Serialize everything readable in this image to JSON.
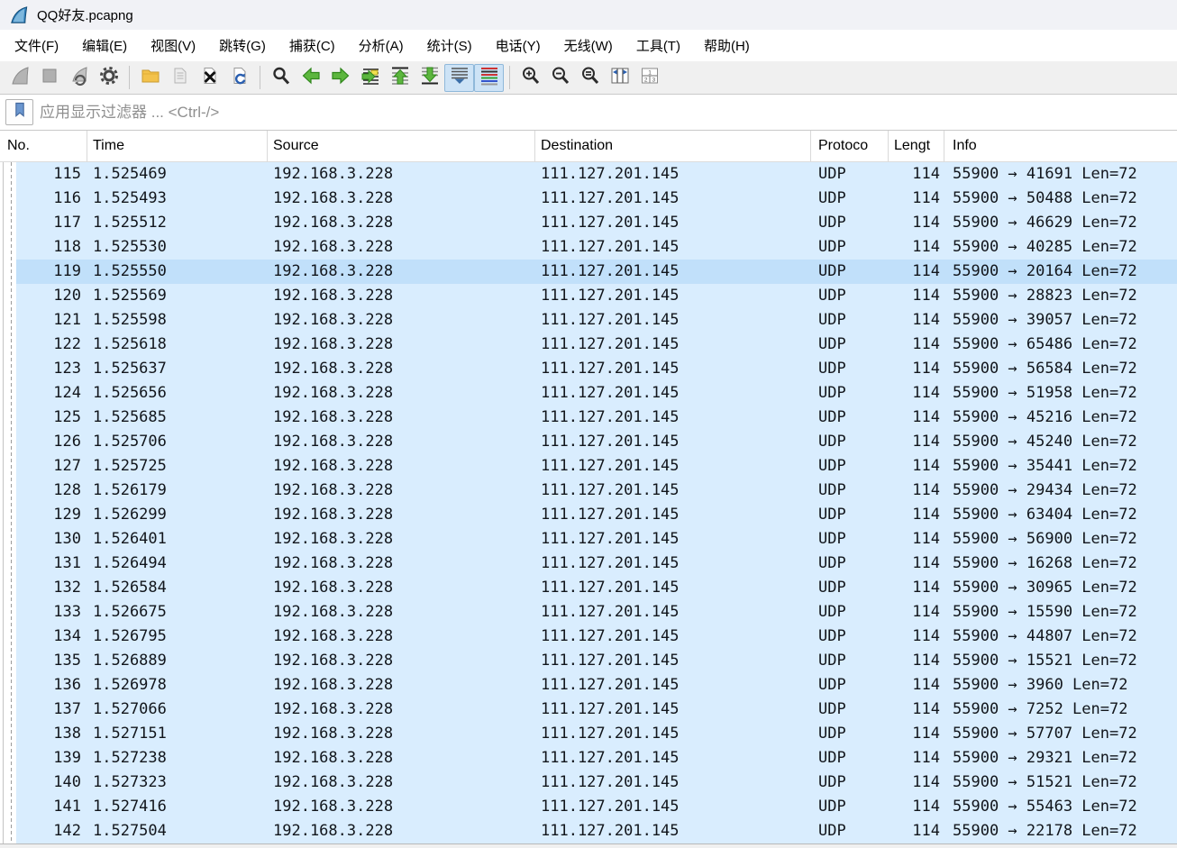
{
  "window": {
    "title": "QQ好友.pcapng",
    "app_icon": "wireshark-fin-icon"
  },
  "menu": {
    "items": [
      {
        "name": "file",
        "label": "文件(F)"
      },
      {
        "name": "edit",
        "label": "编辑(E)"
      },
      {
        "name": "view",
        "label": "视图(V)"
      },
      {
        "name": "go",
        "label": "跳转(G)"
      },
      {
        "name": "capture",
        "label": "捕获(C)"
      },
      {
        "name": "analyze",
        "label": "分析(A)"
      },
      {
        "name": "statistics",
        "label": "统计(S)"
      },
      {
        "name": "telephony",
        "label": "电话(Y)"
      },
      {
        "name": "wireless",
        "label": "无线(W)"
      },
      {
        "name": "tools",
        "label": "工具(T)"
      },
      {
        "name": "help",
        "label": "帮助(H)"
      }
    ]
  },
  "toolbar": {
    "buttons": [
      {
        "icon": "start-capture-icon",
        "enabled": false,
        "active": false
      },
      {
        "icon": "stop-capture-icon",
        "enabled": false,
        "active": false
      },
      {
        "icon": "restart-capture-icon",
        "enabled": false,
        "active": false
      },
      {
        "icon": "capture-options-icon",
        "enabled": true,
        "active": false
      },
      {
        "icon": "open-file-icon",
        "enabled": true,
        "active": false
      },
      {
        "icon": "save-file-icon",
        "enabled": false,
        "active": false
      },
      {
        "icon": "close-file-icon",
        "enabled": true,
        "active": false
      },
      {
        "icon": "reload-file-icon",
        "enabled": true,
        "active": false
      },
      {
        "icon": "find-packet-icon",
        "enabled": true,
        "active": false
      },
      {
        "icon": "go-back-icon",
        "enabled": true,
        "active": false
      },
      {
        "icon": "go-forward-icon",
        "enabled": true,
        "active": false
      },
      {
        "icon": "go-to-packet-icon",
        "enabled": true,
        "active": false
      },
      {
        "icon": "go-first-icon",
        "enabled": true,
        "active": false
      },
      {
        "icon": "go-last-icon",
        "enabled": true,
        "active": false
      },
      {
        "icon": "auto-scroll-icon",
        "enabled": true,
        "active": true
      },
      {
        "icon": "colorize-icon",
        "enabled": true,
        "active": true
      },
      {
        "icon": "zoom-in-icon",
        "enabled": true,
        "active": false
      },
      {
        "icon": "zoom-out-icon",
        "enabled": true,
        "active": false
      },
      {
        "icon": "zoom-original-icon",
        "enabled": true,
        "active": false
      },
      {
        "icon": "resize-columns-icon",
        "enabled": true,
        "active": false
      },
      {
        "icon": "layout-icon",
        "enabled": true,
        "active": false
      }
    ]
  },
  "filter": {
    "placeholder": "应用显示过滤器 ... <Ctrl-/>",
    "value": ""
  },
  "packet_list": {
    "columns": [
      "No.",
      "Time",
      "Source",
      "Destination",
      "Protoco",
      "Lengt",
      "Info"
    ],
    "selected_no": "119",
    "colors": {
      "row_bg": "#d9edfe",
      "selected_row_bg": "#c1e0fa",
      "text": "#12161c"
    },
    "rows": [
      {
        "no": "115",
        "time": "1.525469",
        "source": "192.168.3.228",
        "destination": "111.127.201.145",
        "protocol": "UDP",
        "length": "114",
        "info": "55900 → 41691 Len=72"
      },
      {
        "no": "116",
        "time": "1.525493",
        "source": "192.168.3.228",
        "destination": "111.127.201.145",
        "protocol": "UDP",
        "length": "114",
        "info": "55900 → 50488 Len=72"
      },
      {
        "no": "117",
        "time": "1.525512",
        "source": "192.168.3.228",
        "destination": "111.127.201.145",
        "protocol": "UDP",
        "length": "114",
        "info": "55900 → 46629 Len=72"
      },
      {
        "no": "118",
        "time": "1.525530",
        "source": "192.168.3.228",
        "destination": "111.127.201.145",
        "protocol": "UDP",
        "length": "114",
        "info": "55900 → 40285 Len=72"
      },
      {
        "no": "119",
        "time": "1.525550",
        "source": "192.168.3.228",
        "destination": "111.127.201.145",
        "protocol": "UDP",
        "length": "114",
        "info": "55900 → 20164 Len=72"
      },
      {
        "no": "120",
        "time": "1.525569",
        "source": "192.168.3.228",
        "destination": "111.127.201.145",
        "protocol": "UDP",
        "length": "114",
        "info": "55900 → 28823 Len=72"
      },
      {
        "no": "121",
        "time": "1.525598",
        "source": "192.168.3.228",
        "destination": "111.127.201.145",
        "protocol": "UDP",
        "length": "114",
        "info": "55900 → 39057 Len=72"
      },
      {
        "no": "122",
        "time": "1.525618",
        "source": "192.168.3.228",
        "destination": "111.127.201.145",
        "protocol": "UDP",
        "length": "114",
        "info": "55900 → 65486 Len=72"
      },
      {
        "no": "123",
        "time": "1.525637",
        "source": "192.168.3.228",
        "destination": "111.127.201.145",
        "protocol": "UDP",
        "length": "114",
        "info": "55900 → 56584 Len=72"
      },
      {
        "no": "124",
        "time": "1.525656",
        "source": "192.168.3.228",
        "destination": "111.127.201.145",
        "protocol": "UDP",
        "length": "114",
        "info": "55900 → 51958 Len=72"
      },
      {
        "no": "125",
        "time": "1.525685",
        "source": "192.168.3.228",
        "destination": "111.127.201.145",
        "protocol": "UDP",
        "length": "114",
        "info": "55900 → 45216 Len=72"
      },
      {
        "no": "126",
        "time": "1.525706",
        "source": "192.168.3.228",
        "destination": "111.127.201.145",
        "protocol": "UDP",
        "length": "114",
        "info": "55900 → 45240 Len=72"
      },
      {
        "no": "127",
        "time": "1.525725",
        "source": "192.168.3.228",
        "destination": "111.127.201.145",
        "protocol": "UDP",
        "length": "114",
        "info": "55900 → 35441 Len=72"
      },
      {
        "no": "128",
        "time": "1.526179",
        "source": "192.168.3.228",
        "destination": "111.127.201.145",
        "protocol": "UDP",
        "length": "114",
        "info": "55900 → 29434 Len=72"
      },
      {
        "no": "129",
        "time": "1.526299",
        "source": "192.168.3.228",
        "destination": "111.127.201.145",
        "protocol": "UDP",
        "length": "114",
        "info": "55900 → 63404 Len=72"
      },
      {
        "no": "130",
        "time": "1.526401",
        "source": "192.168.3.228",
        "destination": "111.127.201.145",
        "protocol": "UDP",
        "length": "114",
        "info": "55900 → 56900 Len=72"
      },
      {
        "no": "131",
        "time": "1.526494",
        "source": "192.168.3.228",
        "destination": "111.127.201.145",
        "protocol": "UDP",
        "length": "114",
        "info": "55900 → 16268 Len=72"
      },
      {
        "no": "132",
        "time": "1.526584",
        "source": "192.168.3.228",
        "destination": "111.127.201.145",
        "protocol": "UDP",
        "length": "114",
        "info": "55900 → 30965 Len=72"
      },
      {
        "no": "133",
        "time": "1.526675",
        "source": "192.168.3.228",
        "destination": "111.127.201.145",
        "protocol": "UDP",
        "length": "114",
        "info": "55900 → 15590 Len=72"
      },
      {
        "no": "134",
        "time": "1.526795",
        "source": "192.168.3.228",
        "destination": "111.127.201.145",
        "protocol": "UDP",
        "length": "114",
        "info": "55900 → 44807 Len=72"
      },
      {
        "no": "135",
        "time": "1.526889",
        "source": "192.168.3.228",
        "destination": "111.127.201.145",
        "protocol": "UDP",
        "length": "114",
        "info": "55900 → 15521 Len=72"
      },
      {
        "no": "136",
        "time": "1.526978",
        "source": "192.168.3.228",
        "destination": "111.127.201.145",
        "protocol": "UDP",
        "length": "114",
        "info": "55900 → 3960 Len=72"
      },
      {
        "no": "137",
        "time": "1.527066",
        "source": "192.168.3.228",
        "destination": "111.127.201.145",
        "protocol": "UDP",
        "length": "114",
        "info": "55900 → 7252 Len=72"
      },
      {
        "no": "138",
        "time": "1.527151",
        "source": "192.168.3.228",
        "destination": "111.127.201.145",
        "protocol": "UDP",
        "length": "114",
        "info": "55900 → 57707 Len=72"
      },
      {
        "no": "139",
        "time": "1.527238",
        "source": "192.168.3.228",
        "destination": "111.127.201.145",
        "protocol": "UDP",
        "length": "114",
        "info": "55900 → 29321 Len=72"
      },
      {
        "no": "140",
        "time": "1.527323",
        "source": "192.168.3.228",
        "destination": "111.127.201.145",
        "protocol": "UDP",
        "length": "114",
        "info": "55900 → 51521 Len=72"
      },
      {
        "no": "141",
        "time": "1.527416",
        "source": "192.168.3.228",
        "destination": "111.127.201.145",
        "protocol": "UDP",
        "length": "114",
        "info": "55900 → 55463 Len=72"
      },
      {
        "no": "142",
        "time": "1.527504",
        "source": "192.168.3.228",
        "destination": "111.127.201.145",
        "protocol": "UDP",
        "length": "114",
        "info": "55900 → 22178 Len=72"
      }
    ]
  }
}
